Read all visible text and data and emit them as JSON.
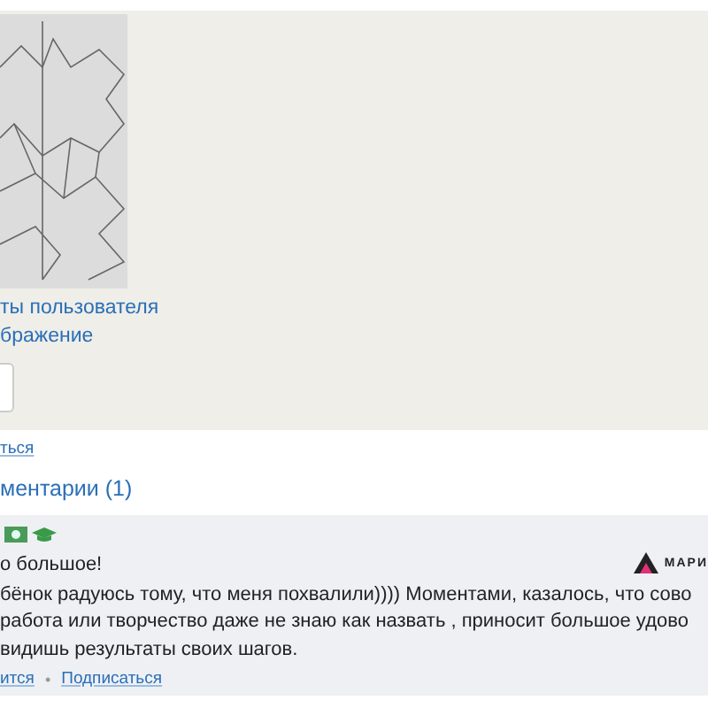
{
  "panel": {
    "links": [
      "ты пользователя",
      "бражение"
    ]
  },
  "action_link": "ться",
  "comments_heading": "ментарии (1)",
  "comment": {
    "title": "о большое!",
    "lines": [
      "бёнок радуюсь тому, что меня похвалили)))) Моментами, казалось, что сово",
      "работа или творчество даже не знаю как назвать , приносит большое удово",
      "видишь результаты своих шагов."
    ],
    "brand": "МАРИ",
    "separator": "•",
    "actions": [
      "ится",
      "Подписаться"
    ]
  }
}
